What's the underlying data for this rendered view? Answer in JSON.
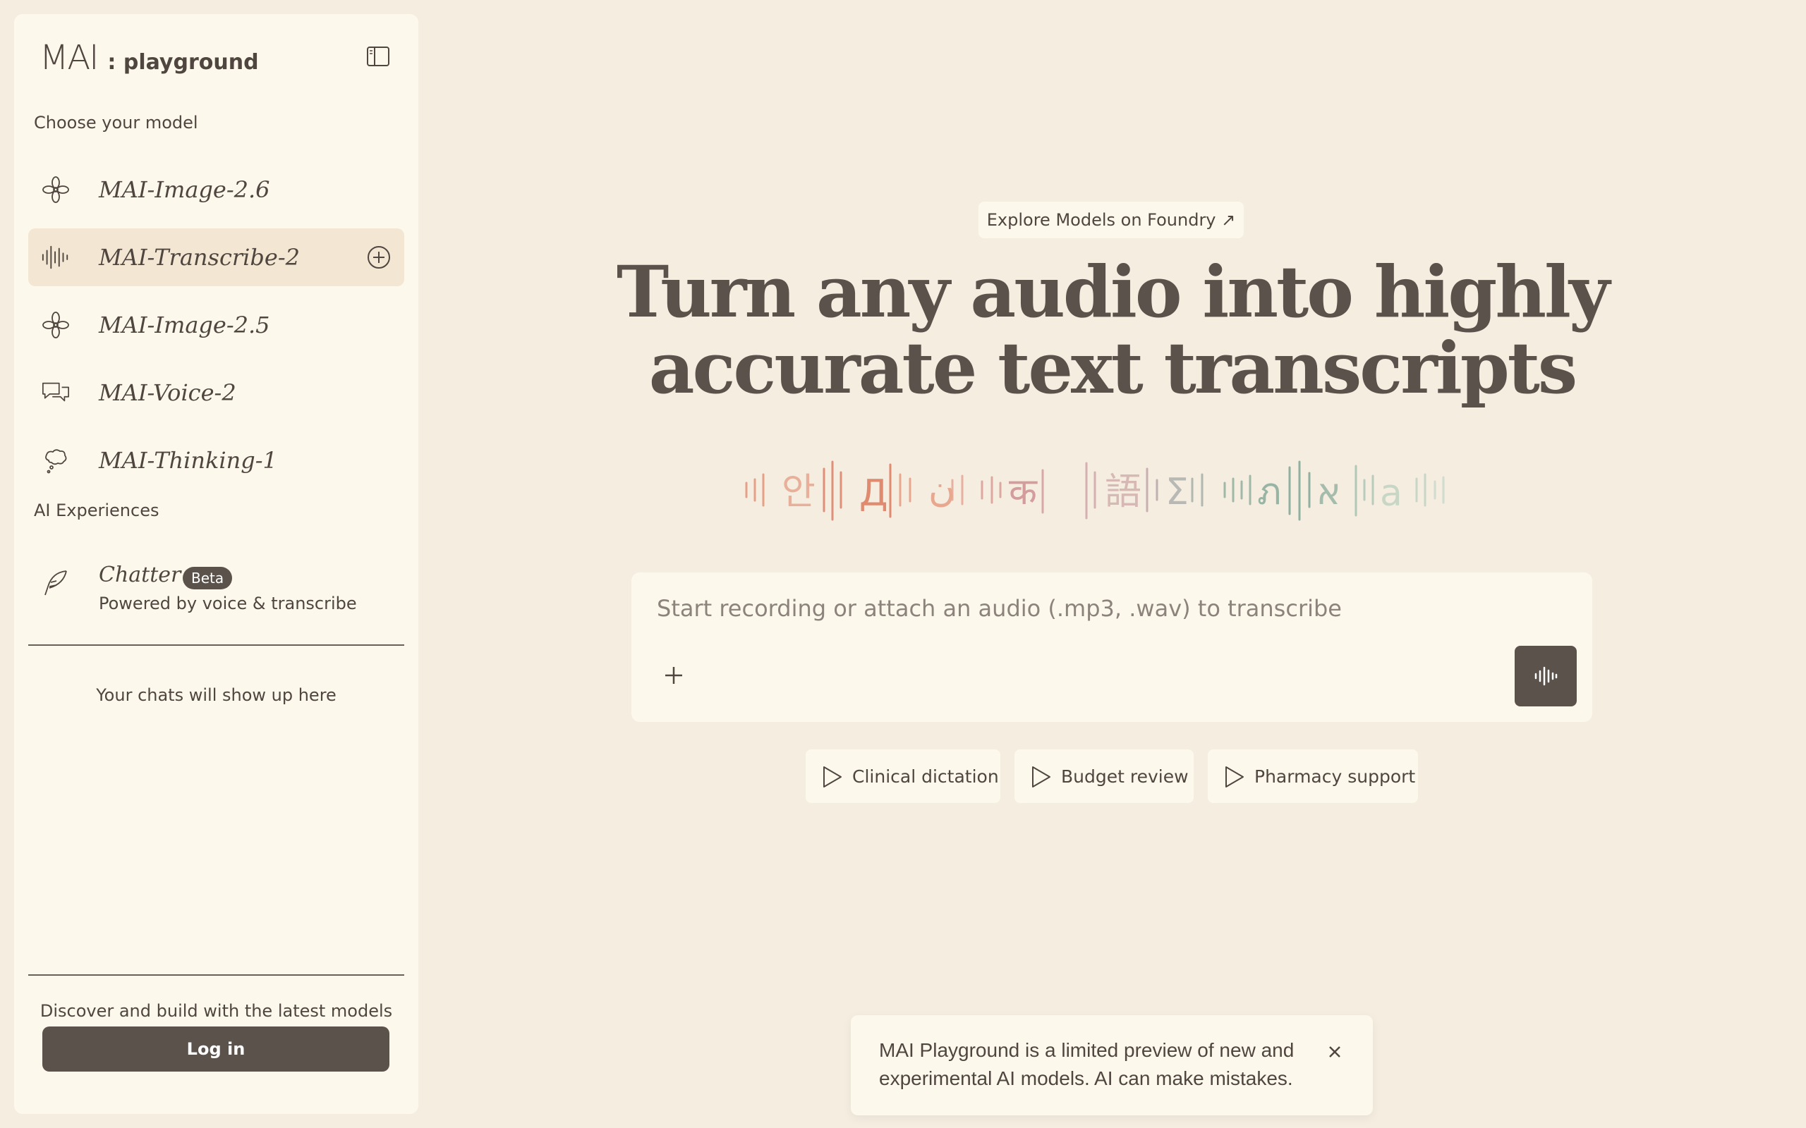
{
  "brand": {
    "logo": "MAI",
    "subtitle": ": playground"
  },
  "sidebar": {
    "choose_label": "Choose your model",
    "models": [
      {
        "label": "MAI-Image-2.6",
        "icon": "flower-icon"
      },
      {
        "label": "MAI-Transcribe-2",
        "icon": "waveform-icon",
        "active": true
      },
      {
        "label": "MAI-Image-2.5",
        "icon": "flower-icon"
      },
      {
        "label": "MAI-Voice-2",
        "icon": "chat-bubbles-icon"
      },
      {
        "label": "MAI-Thinking-1",
        "icon": "thought-bubble-icon"
      }
    ],
    "experiences_label": "AI Experiences",
    "chatter": {
      "name": "Chatter",
      "badge": "Beta",
      "description": "Powered by voice & transcribe"
    },
    "empty_chats": "Your chats will show up here",
    "discover": "Discover and build with the latest models",
    "login": "Log in"
  },
  "main": {
    "explore": "Explore Models on Foundry ↗",
    "headline_line1": "Turn any audio into highly",
    "headline_line2": "accurate text transcripts",
    "waveform_glyphs": [
      "안",
      "Д",
      "ن",
      "क",
      "語",
      "Σ",
      "ภ",
      "א",
      "a"
    ],
    "input_placeholder": "Start recording or attach an audio (.mp3, .wav) to transcribe",
    "chips": [
      "Clinical dictation",
      "Budget review",
      "Pharmacy support"
    ]
  },
  "toast": {
    "text": "MAI Playground is a limited preview of new and experimental AI models. AI can make mistakes."
  },
  "colors": {
    "background": "#f5ede0",
    "panel": "#fdf8ec",
    "accent": "#5c524c",
    "active": "#f3e6d2"
  }
}
